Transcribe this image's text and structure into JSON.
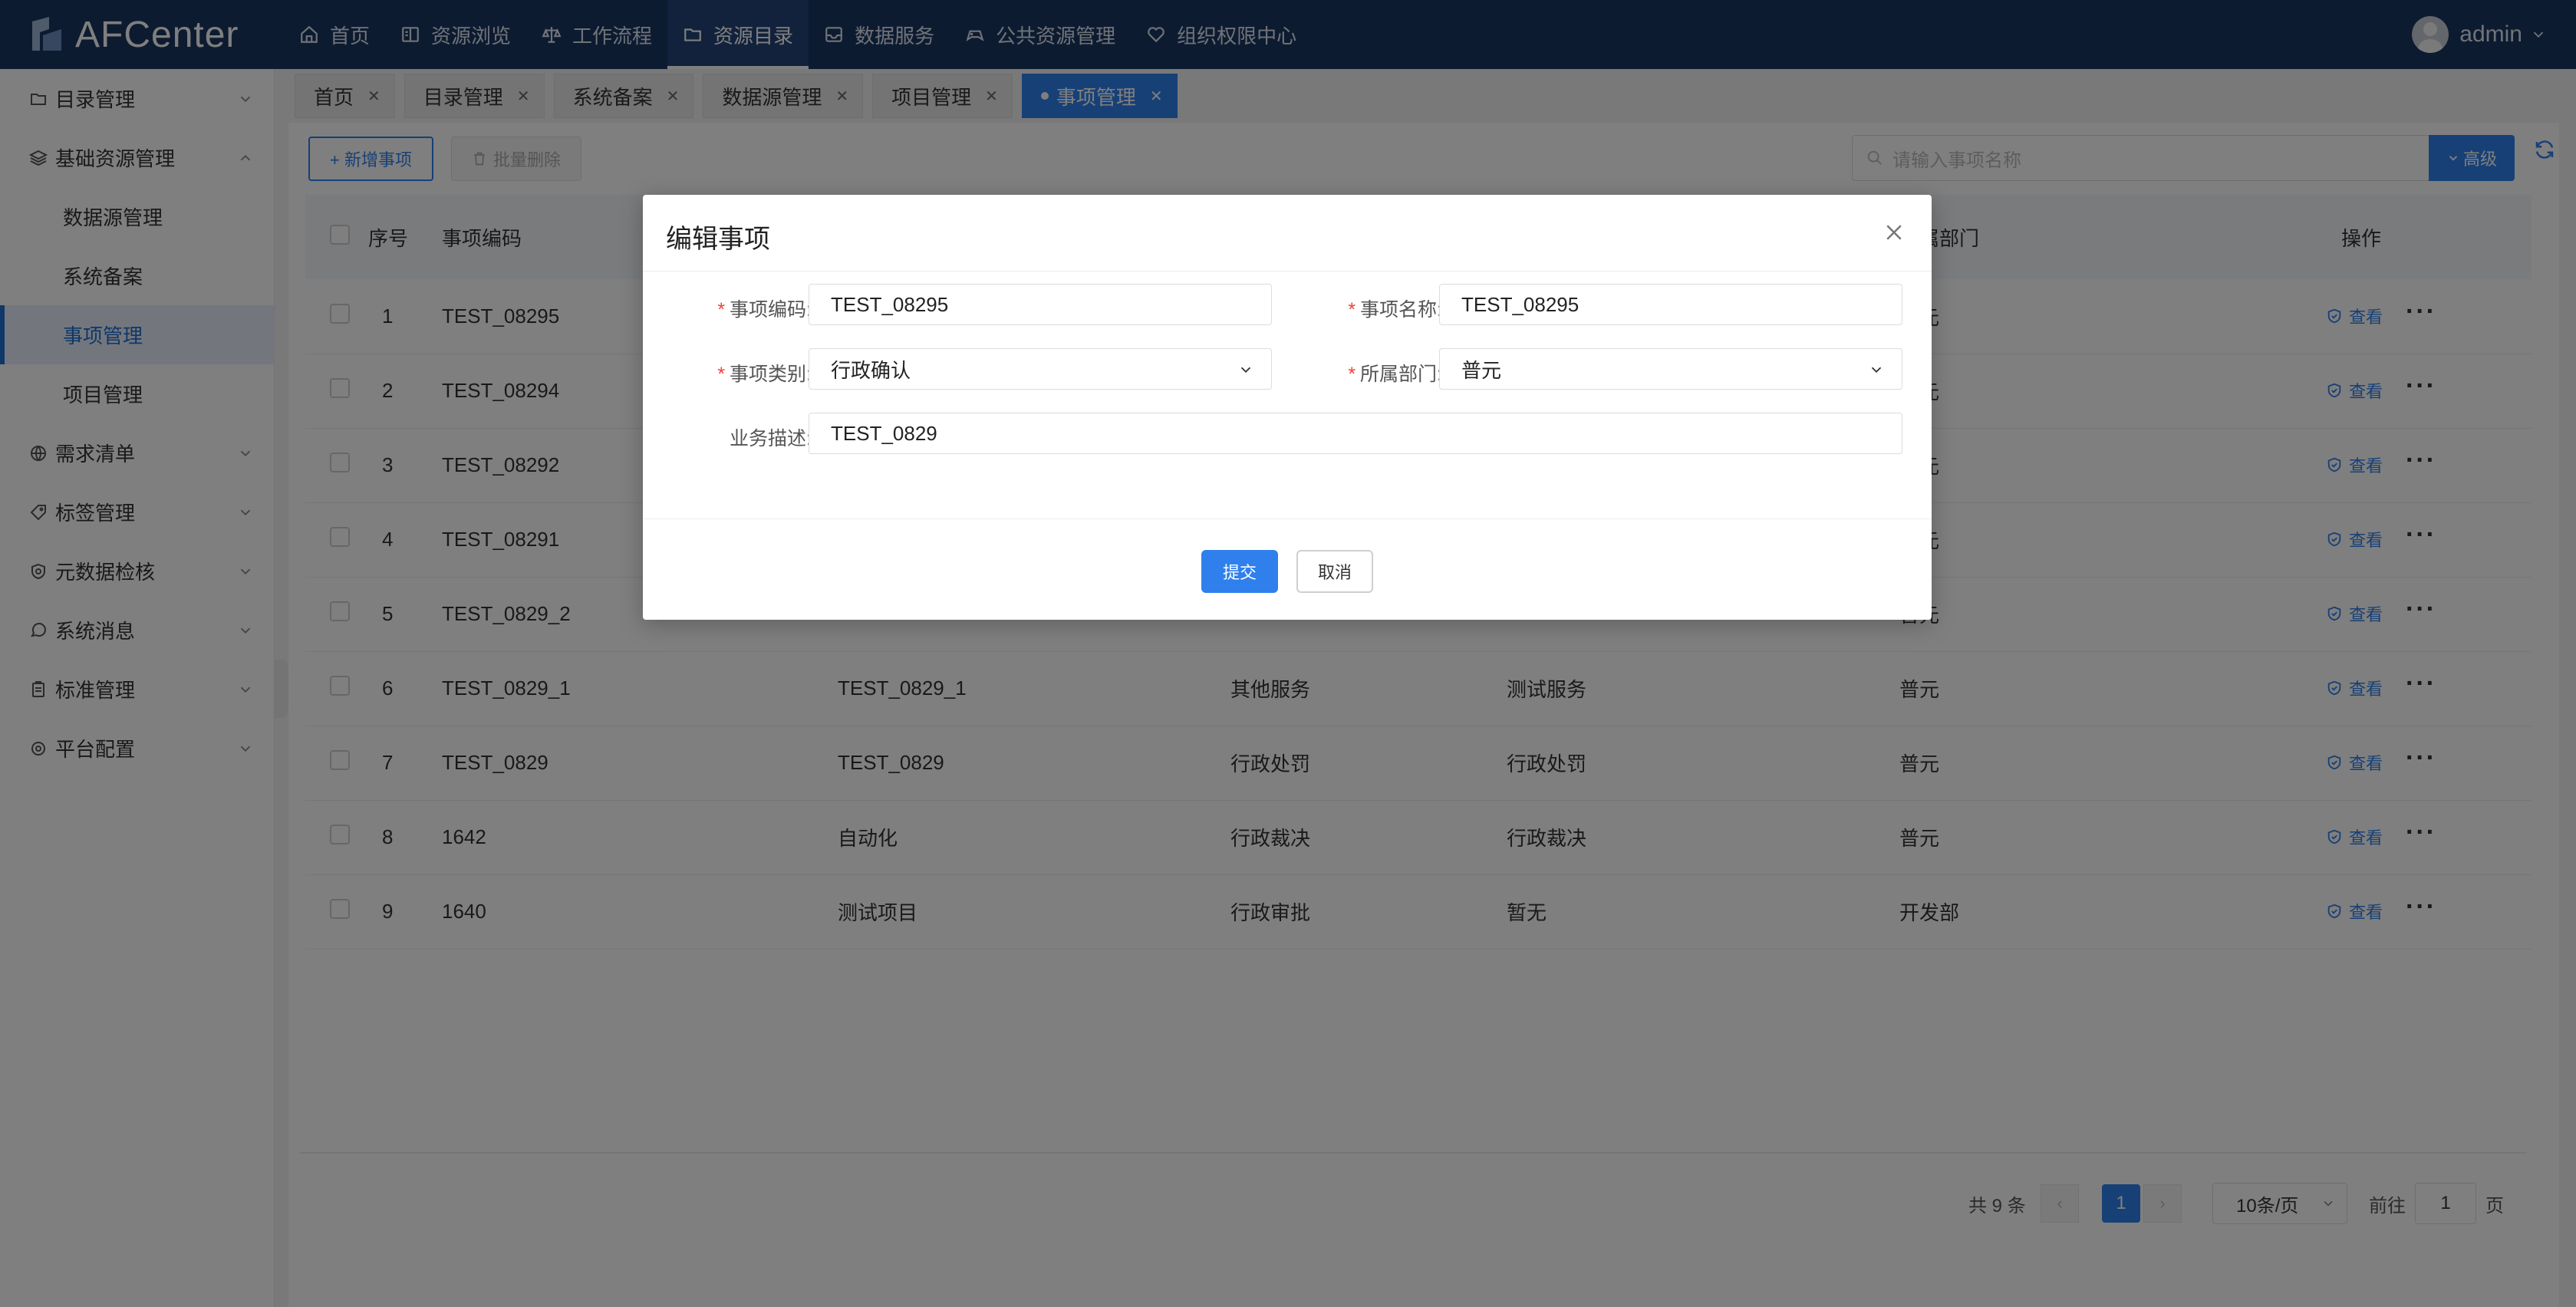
{
  "app": {
    "name": "AFCenter"
  },
  "nav": [
    {
      "label": "首页",
      "icon": "home-icon"
    },
    {
      "label": "资源浏览",
      "icon": "book-icon"
    },
    {
      "label": "工作流程",
      "icon": "scale-icon"
    },
    {
      "label": "资源目录",
      "icon": "folder-icon",
      "active": true
    },
    {
      "label": "数据服务",
      "icon": "inbox-icon"
    },
    {
      "label": "公共资源管理",
      "icon": "gamepad-icon"
    },
    {
      "label": "组织权限中心",
      "icon": "heart-icon"
    }
  ],
  "user": {
    "name": "admin"
  },
  "sidebar": {
    "items": [
      {
        "label": "目录管理",
        "icon": "folder-icon"
      },
      {
        "label": "基础资源管理",
        "icon": "layers-icon",
        "expanded": true
      },
      {
        "label": "需求清单",
        "icon": "globe-icon"
      },
      {
        "label": "标签管理",
        "icon": "tag-icon"
      },
      {
        "label": "元数据检核",
        "icon": "shield-icon"
      },
      {
        "label": "系统消息",
        "icon": "chat-icon"
      },
      {
        "label": "标准管理",
        "icon": "clipboard-icon"
      },
      {
        "label": "平台配置",
        "icon": "gear-icon"
      }
    ],
    "sub": [
      "数据源管理",
      "系统备案",
      "事项管理",
      "项目管理"
    ],
    "active_sub": "事项管理"
  },
  "tabs": [
    {
      "label": "首页"
    },
    {
      "label": "目录管理"
    },
    {
      "label": "系统备案"
    },
    {
      "label": "数据源管理"
    },
    {
      "label": "项目管理"
    },
    {
      "label": "事项管理",
      "active": true
    }
  ],
  "toolbar": {
    "add_label": "+ 新增事项",
    "delete_label": "批量删除",
    "search_placeholder": "请输入事项名称",
    "advanced_label": "高级"
  },
  "table": {
    "headers": {
      "index": "序号",
      "code": "事项编码",
      "name": "",
      "category": "",
      "type": "",
      "dept": "所属部门",
      "ops": "操作"
    },
    "view_label": "查看",
    "more_label": "···",
    "rows": [
      {
        "index": "1",
        "code": "TEST_08295",
        "name": "",
        "category": "",
        "type": "",
        "dept": "普元"
      },
      {
        "index": "2",
        "code": "TEST_08294",
        "name": "",
        "category": "",
        "type": "",
        "dept": "普元"
      },
      {
        "index": "3",
        "code": "TEST_08292",
        "name": "",
        "category": "",
        "type": "",
        "dept": "普元"
      },
      {
        "index": "4",
        "code": "TEST_08291",
        "name": "",
        "category": "",
        "type": "",
        "dept": "普元"
      },
      {
        "index": "5",
        "code": "TEST_0829_2",
        "name": "",
        "category": "",
        "type": "",
        "dept": "普元"
      },
      {
        "index": "6",
        "code": "TEST_0829_1",
        "name": "TEST_0829_1",
        "category": "其他服务",
        "type": "测试服务",
        "dept": "普元"
      },
      {
        "index": "7",
        "code": "TEST_0829",
        "name": "TEST_0829",
        "category": "行政处罚",
        "type": "行政处罚",
        "dept": "普元"
      },
      {
        "index": "8",
        "code": "1642",
        "name": "自动化",
        "category": "行政裁决",
        "type": "行政裁决",
        "dept": "普元"
      },
      {
        "index": "9",
        "code": "1640",
        "name": "测试项目",
        "category": "行政审批",
        "type": "暂无",
        "dept": "开发部"
      }
    ]
  },
  "pager": {
    "total_label": "共 9 条",
    "prev": "‹",
    "current": "1",
    "next": "›",
    "size_label": "10条/页",
    "goto_label": "前往",
    "goto_value": "1",
    "page_label": "页"
  },
  "modal": {
    "title": "编辑事项",
    "fields": {
      "code_label": "事项编码:",
      "code_value": "TEST_08295",
      "name_label": "事项名称:",
      "name_value": "TEST_08295",
      "category_label": "事项类别:",
      "category_value": "行政确认",
      "dept_label": "所属部门:",
      "dept_value": "普元",
      "desc_label": "业务描述:",
      "desc_value": "TEST_0829"
    },
    "submit_label": "提交",
    "cancel_label": "取消"
  },
  "colors": {
    "header_bg": "#1b3763",
    "accent": "#2f80ed",
    "required": "#f04134"
  }
}
